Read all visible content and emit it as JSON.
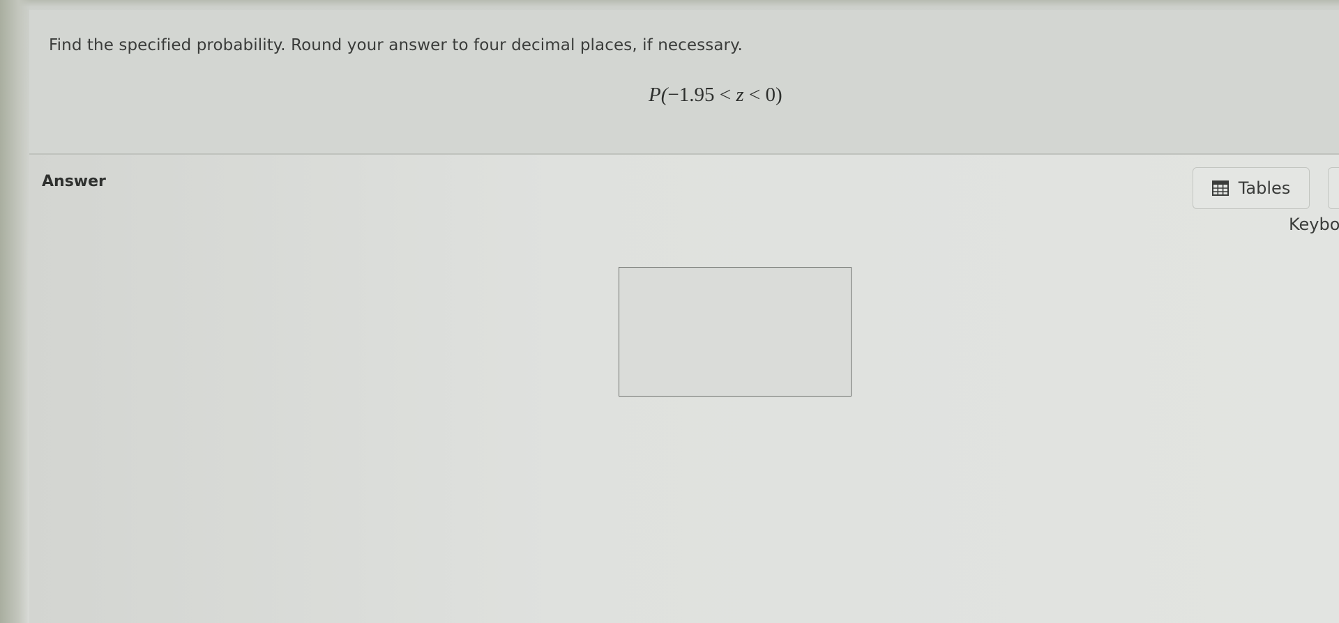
{
  "question": {
    "instruction": "Find the specified probability. Round your answer to four decimal places, if necessary.",
    "expression": {
      "prefix": "P(",
      "lower": "−1.95",
      "lt1": "<",
      "variable": "z",
      "lt2": "<",
      "upper": "0",
      "suffix": ")"
    }
  },
  "answer": {
    "label": "Answer",
    "input_value": ""
  },
  "toolbar": {
    "tables_label": "Tables",
    "tables_icon": "table-grid-icon",
    "keyboard_label": "Keybo"
  },
  "colors": {
    "background": "#d6d8d4",
    "text": "#3a3c3a",
    "input_border": "#6e716d"
  }
}
